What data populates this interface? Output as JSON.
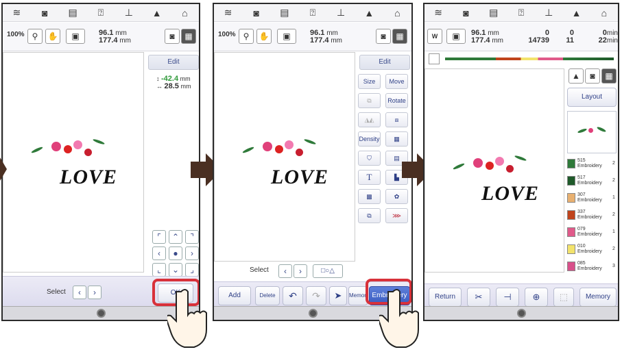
{
  "status_icons": [
    "wifi-icon",
    "camera-icon",
    "document-icon",
    "help-icon",
    "thread-spool-icon",
    "lock-icon",
    "home-icon"
  ],
  "panel1": {
    "zoom": "100%",
    "width_value": "96.1",
    "height_value": "177.4",
    "unit": "mm",
    "side_header": "Edit",
    "offset_y": "-42.4",
    "offset_x": "28.5",
    "offset_unit": "mm",
    "design_text": "LOVE",
    "select_label": "Select",
    "ok_label": "OK"
  },
  "panel2": {
    "zoom": "100%",
    "width_value": "96.1",
    "height_value": "177.4",
    "unit": "mm",
    "side_header": "Edit",
    "tools": [
      "Size",
      "Move",
      "",
      "Rotate",
      "",
      "",
      "Density",
      "",
      "",
      "",
      "T",
      "",
      "",
      "",
      ""
    ],
    "design_text": "LOVE",
    "select_label": "Select",
    "add_label": "Add",
    "delete_label": "Delete",
    "memory_label": "Memory",
    "embroidery_label": "Embroidery"
  },
  "panel3": {
    "width_value": "96.1",
    "height_value": "177.4",
    "unit": "mm",
    "stitch_value": "0",
    "stitch_total": "14739",
    "color_value": "0",
    "color_total": "11",
    "time_value": "0",
    "time_total": "22",
    "time_unit": "min",
    "layout_label": "Layout",
    "design_text": "LOVE",
    "threads": [
      {
        "code": "515",
        "name": "Embroidery",
        "count": "2",
        "color": "#2f7a3a"
      },
      {
        "code": "517",
        "name": "Embroidery",
        "count": "2",
        "color": "#1f5a2a"
      },
      {
        "code": "307",
        "name": "Embroidery",
        "count": "1",
        "color": "#e8b070"
      },
      {
        "code": "337",
        "name": "Embroidery",
        "count": "2",
        "color": "#c0441c"
      },
      {
        "code": "079",
        "name": "Embroidery",
        "count": "1",
        "color": "#e05a8a"
      },
      {
        "code": "010",
        "name": "Embroidery",
        "count": "2",
        "color": "#f3e36c"
      },
      {
        "code": "085",
        "name": "Embroidery",
        "count": "3",
        "color": "#d8508a"
      }
    ],
    "return_label": "Return",
    "memory_label": "Memory"
  },
  "colors": {
    "highlight": "#d8313a",
    "arrow": "#4a2f22",
    "accent": "#3a5bc0"
  }
}
